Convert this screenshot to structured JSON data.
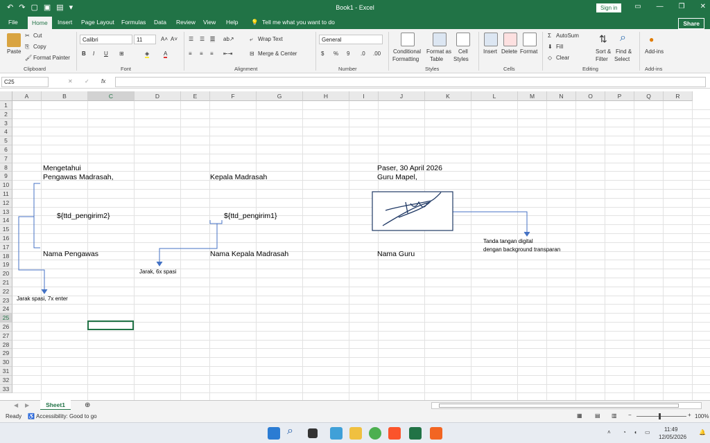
{
  "titlebar": {
    "title": "Book1  -  Excel",
    "signin": "Sign in"
  },
  "tabs": [
    "File",
    "Home",
    "Insert",
    "Page Layout",
    "Formulas",
    "Data",
    "Review",
    "View",
    "Help"
  ],
  "tell_me": "Tell me what you want to do",
  "share": "Share",
  "ribbon": {
    "paste": "Paste",
    "cut": "Cut",
    "copy": "Copy",
    "format_painter": "Format Painter",
    "font_name": "Calibri",
    "font_size": "11",
    "wrap_text": "Wrap Text",
    "merge_center": "Merge & Center",
    "number_format": "General",
    "conditional": "Conditional",
    "formatting": "Formatting",
    "format_as": "Format as",
    "table": "Table",
    "cell": "Cell",
    "styles_btn": "Styles",
    "insert": "Insert",
    "delete": "Delete",
    "format": "Format",
    "autosum": "AutoSum",
    "fill": "Fill",
    "clear": "Clear",
    "sort_filter_1": "Sort &",
    "sort_filter_2": "Filter",
    "find_select_1": "Find &",
    "find_select_2": "Select",
    "addins": "Add-ins",
    "groups": [
      "Clipboard",
      "Font",
      "Alignment",
      "Number",
      "Styles",
      "Cells",
      "Editing",
      "Add-ins"
    ]
  },
  "formula_bar": {
    "name_box": "C25",
    "formula": ""
  },
  "columns": [
    "A",
    "B",
    "C",
    "D",
    "E",
    "F",
    "G",
    "H",
    "I",
    "J",
    "K",
    "L",
    "M",
    "N",
    "O",
    "P",
    "Q",
    "R"
  ],
  "rows": [
    "1",
    "2",
    "3",
    "4",
    "5",
    "6",
    "7",
    "8",
    "9",
    "10",
    "11",
    "12",
    "13",
    "14",
    "15",
    "16",
    "17",
    "18",
    "19",
    "20",
    "21",
    "22",
    "23",
    "24",
    "25",
    "26",
    "27",
    "28",
    "29",
    "30",
    "31",
    "32",
    "33"
  ],
  "cells": {
    "b8": "Mengetahui",
    "b9": "Pengawas Madrasah,",
    "b13": "${ttd_pengirim2}",
    "b17": "Nama Pengawas",
    "f9": "Kepala Madrasah",
    "f13": "${ttd_pengirim1}",
    "f17": "Nama Kepala Madrasah",
    "j8": "Paser, 30 April 2026",
    "j9": "Guru Mapel,",
    "j17": "Nama Guru"
  },
  "annotations": {
    "a22": "Jarak spasi, 7x enter",
    "d19": "Jarak, 6x spasi",
    "sig1": "Tanda tangan digital",
    "sig2": "dengan background transparan"
  },
  "sheet_tab": "Sheet1",
  "status": {
    "ready": "Ready",
    "accessibility": "Accessibility: Good to go",
    "zoom": "100%"
  },
  "taskbar": {
    "time": "11:49",
    "date": "12/05/2026"
  }
}
